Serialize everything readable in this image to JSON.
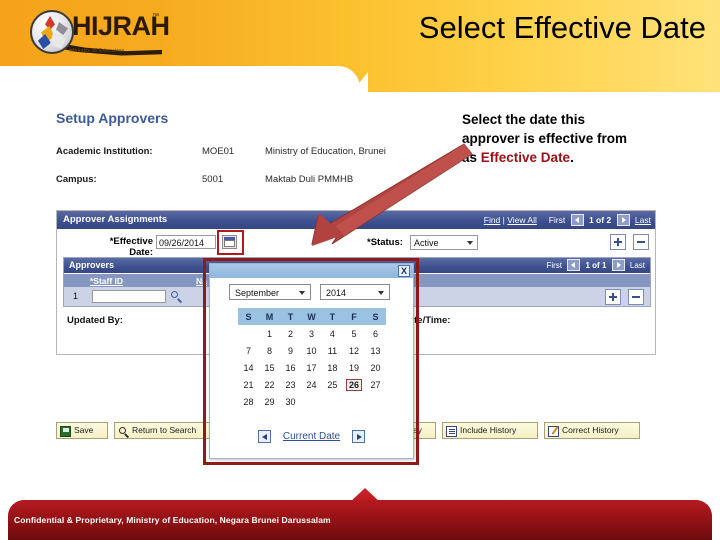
{
  "header": {
    "logo_text": "HIJRAH",
    "logo_tm": "™",
    "logo_tagline": "Ministry of Education",
    "title": "Select Effective Date"
  },
  "note": {
    "line1": "Select the date this",
    "line2": "approver is effective from",
    "line3_pre": "as ",
    "line3_hot": "Effective Date",
    "line3_post": "."
  },
  "screenshot": {
    "page_title": "Setup Approvers",
    "fields": [
      {
        "label": "Academic Institution:",
        "code": "MOE01",
        "desc": "Ministry of Education, Brunei"
      },
      {
        "label": "Campus:",
        "code": "5001",
        "desc": "Maktab Duli PMMHB"
      }
    ],
    "panel": {
      "title": "Approver Assignments",
      "find_label": "Find",
      "sep": "|",
      "view_all_label": "View All",
      "first_label": "First",
      "counter": "1 of 2",
      "last_label": "Last",
      "effective_date_label": "*Effective Date:",
      "effective_date_value": "09/26/2014",
      "calendar_icon": "calendar-icon",
      "status_label": "*Status:",
      "status_value": "Active",
      "add_row_label": "+",
      "delete_row_label": "−"
    },
    "approvers": {
      "title": "Approvers",
      "first_label": "First",
      "counter": "1 of 1",
      "last_label": "Last",
      "columns": [
        "*Staff ID",
        "Na"
      ],
      "row_number": "1",
      "staff_id_value": "",
      "lookup_icon": "magnifier-icon",
      "add_row_label": "+",
      "delete_row_label": "−"
    },
    "updated_by_label": "Updated By:",
    "date_time_label": "Date/Time:",
    "buttons": [
      {
        "label": "Save",
        "icon": "disk-icon"
      },
      {
        "label": "Return to Search",
        "icon": "search-icon"
      },
      {
        "label": "Display",
        "icon": "refresh-icon"
      },
      {
        "label": "Include History",
        "icon": "document-icon"
      },
      {
        "label": "Correct History",
        "icon": "pencil-icon"
      }
    ]
  },
  "calendar": {
    "close_label": "X",
    "month": "September",
    "year": "2014",
    "weekdays": [
      "S",
      "M",
      "T",
      "W",
      "T",
      "F",
      "S"
    ],
    "weeks": [
      [
        "",
        "1",
        "2",
        "3",
        "4",
        "5",
        "6"
      ],
      [
        "7",
        "8",
        "9",
        "10",
        "11",
        "12",
        "13"
      ],
      [
        "14",
        "15",
        "16",
        "17",
        "18",
        "19",
        "20"
      ],
      [
        "21",
        "22",
        "23",
        "24",
        "25",
        "26",
        "27"
      ],
      [
        "28",
        "29",
        "30",
        "",
        "",
        "",
        ""
      ]
    ],
    "selected_day": "26",
    "current_date_label": "Current Date",
    "prev_icon": "chevron-left-icon",
    "next_icon": "chevron-right-icon"
  },
  "footer": {
    "text": "Confidential & Proprietary, Ministry of Education, Negara Brunei Darussalam"
  },
  "colors": {
    "header_start": "#f5a31a",
    "header_end": "#ffe27a",
    "footer_red": "#8f1114",
    "accent_red": "#9c1016",
    "panel_blue": "#3e5090",
    "highlight_red": "#8f1a1a"
  }
}
